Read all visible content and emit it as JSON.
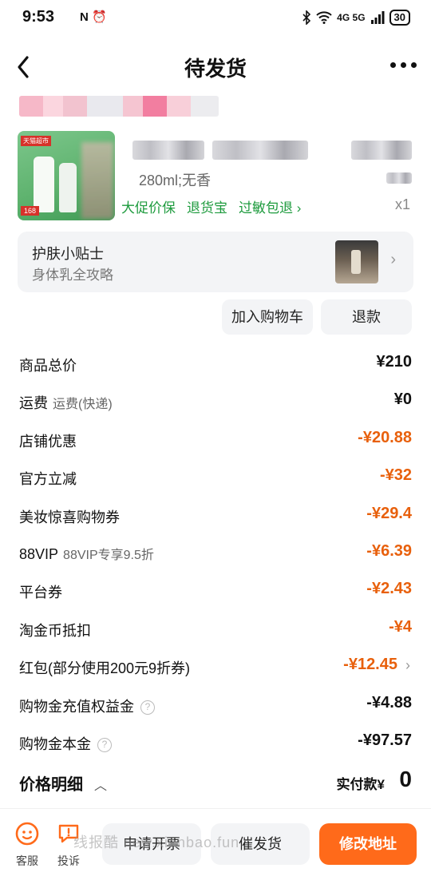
{
  "status_bar": {
    "time": "9:53",
    "left_icons": "N ⏰",
    "network": "4G 5G",
    "battery": "30"
  },
  "nav": {
    "title": "待发货"
  },
  "product": {
    "img_tag": "天猫超市",
    "img_price": "168",
    "spec": "280ml;无香",
    "services": [
      "大促价保",
      "退货宝",
      "过敏包退 ›"
    ],
    "qty": "x1"
  },
  "tip": {
    "title": "护肤小贴士",
    "subtitle": "身体乳全攻略"
  },
  "actions": {
    "add_cart": "加入购物车",
    "refund": "退款"
  },
  "price_rows": [
    {
      "label": "商品总价",
      "note": "",
      "value": "¥210",
      "orange": false,
      "help": false,
      "chevron": false
    },
    {
      "label": "运费",
      "note": "运费(快递)",
      "value": "¥0",
      "orange": false,
      "help": false,
      "chevron": false
    },
    {
      "label": "店铺优惠",
      "note": "",
      "value": "-¥20.88",
      "orange": true,
      "help": false,
      "chevron": false
    },
    {
      "label": "官方立减",
      "note": "",
      "value": "-¥32",
      "orange": true,
      "help": false,
      "chevron": false
    },
    {
      "label": "美妆惊喜购物券",
      "note": "",
      "value": "-¥29.4",
      "orange": true,
      "help": false,
      "chevron": false
    },
    {
      "label": "88VIP",
      "note": "88VIP专享9.5折",
      "value": "-¥6.39",
      "orange": true,
      "help": false,
      "chevron": false
    },
    {
      "label": "平台券",
      "note": "",
      "value": "-¥2.43",
      "orange": true,
      "help": false,
      "chevron": false
    },
    {
      "label": "淘金币抵扣",
      "note": "",
      "value": "-¥4",
      "orange": true,
      "help": false,
      "chevron": false
    },
    {
      "label": "红包(部分使用200元9折券)",
      "note": "",
      "value": "-¥12.45",
      "orange": true,
      "help": false,
      "chevron": true
    },
    {
      "label": "购物金充值权益金",
      "note": "",
      "value": "-¥4.88",
      "orange": false,
      "help": true,
      "chevron": false
    },
    {
      "label": "购物金本金",
      "note": "",
      "value": "-¥97.57",
      "orange": false,
      "help": true,
      "chevron": false
    }
  ],
  "detail": {
    "label": "价格明细",
    "paid_label": "实付款¥",
    "paid_value": "0"
  },
  "bottom": {
    "service": "客服",
    "complaint": "投诉",
    "invoice": "申请开票",
    "urge": "催发货",
    "change_address": "修改地址",
    "watermark": "线报酷 new.xianbao.fun"
  }
}
